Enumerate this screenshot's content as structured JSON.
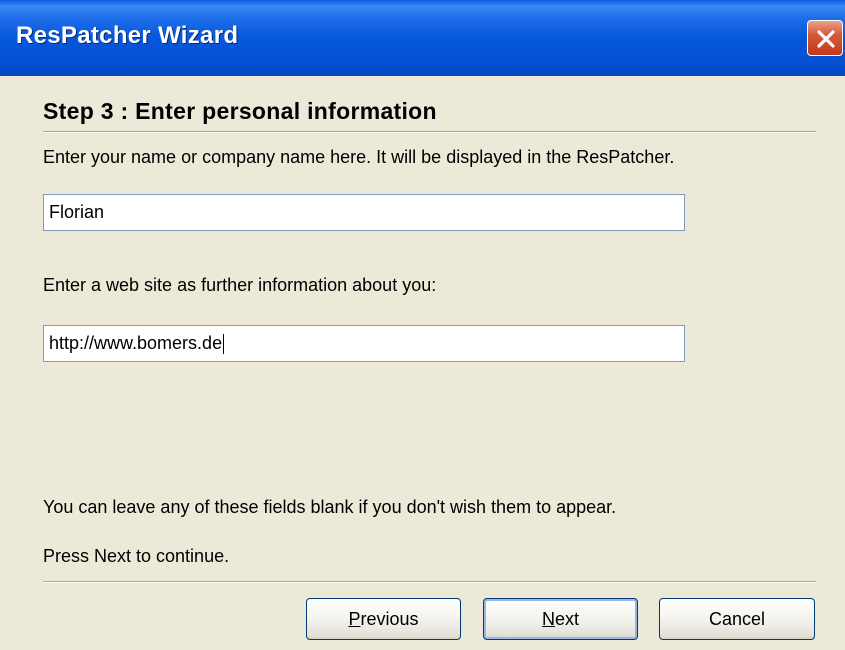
{
  "window": {
    "title": "ResPatcher Wizard"
  },
  "step": {
    "title": "Step 3 : Enter personal information",
    "name_prompt": "Enter your name or company name here. It will be displayed in the ResPatcher.",
    "name_value": "Florian",
    "website_prompt": "Enter a web site as further information about you:",
    "website_value": "http://www.bomers.de",
    "hint_blank": "You can leave any of these fields blank if you don't wish them to appear.",
    "hint_next": "Press Next to continue."
  },
  "buttons": {
    "previous": {
      "mnemonic": "P",
      "rest": "revious"
    },
    "next": {
      "mnemonic": "N",
      "rest": "ext"
    },
    "cancel": "Cancel"
  },
  "colors": {
    "titlebar": "#0757DC",
    "face": "#ECE9D8",
    "close": "#C3381A"
  },
  "icons": {
    "close": "close-icon"
  }
}
